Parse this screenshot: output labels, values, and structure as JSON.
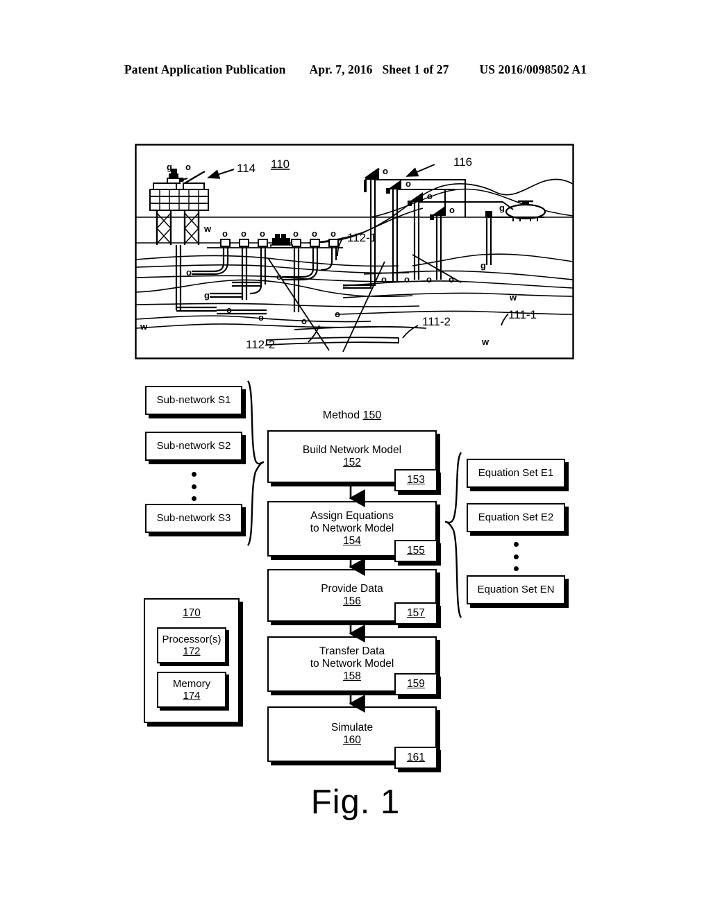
{
  "header": {
    "left": "Patent Application Publication",
    "date": "Apr. 7, 2016",
    "sheet": "Sheet 1 of 27",
    "number": "US 2016/0098502 A1"
  },
  "figure": {
    "caption": "Fig. 1"
  },
  "illustration": {
    "label_110": "110",
    "label_114": "114",
    "label_116": "116",
    "label_112_1": "112-1",
    "label_112_2": "112-2",
    "label_111_1": "111-1",
    "label_111_2": "111-2",
    "fluid_markers": {
      "gas": "g",
      "oil": "o",
      "water": "w"
    },
    "gas_labels": [
      "g",
      "g",
      "g",
      "g"
    ],
    "oil_labels": [
      "o",
      "o",
      "o",
      "o",
      "o",
      "o",
      "o",
      "o",
      "o",
      "o",
      "o",
      "o",
      "o",
      "o",
      "o",
      "o",
      "o",
      "o",
      "o",
      "o",
      "o",
      "o"
    ],
    "water_labels": [
      "w",
      "w",
      "w",
      "w"
    ]
  },
  "method": {
    "title_prefix": "Method ",
    "title_number": "150",
    "steps": [
      {
        "lines": [
          "Build Network Model"
        ],
        "num": "152",
        "tag": "153"
      },
      {
        "lines": [
          "Assign Equations",
          "to Network Model"
        ],
        "num": "154",
        "tag": "155"
      },
      {
        "lines": [
          "Provide Data"
        ],
        "num": "156",
        "tag": "157"
      },
      {
        "lines": [
          "Transfer Data",
          "to Network Model"
        ],
        "num": "158",
        "tag": "159"
      },
      {
        "lines": [
          "Simulate"
        ],
        "num": "160",
        "tag": "161"
      }
    ]
  },
  "subnetworks": {
    "items": [
      {
        "label": "Sub-network S1"
      },
      {
        "label": "Sub-network S2"
      },
      {
        "label": "Sub-network S3"
      }
    ]
  },
  "equationsets": {
    "items": [
      {
        "label": "Equation Set E1"
      },
      {
        "label": "Equation Set E2"
      },
      {
        "label": "Equation Set EN"
      }
    ]
  },
  "system": {
    "num": "170",
    "processor": {
      "label": "Processor(s)",
      "num": "172"
    },
    "memory": {
      "label": "Memory",
      "num": "174"
    }
  },
  "colors": {
    "ink": "#000000",
    "paper": "#ffffff"
  }
}
